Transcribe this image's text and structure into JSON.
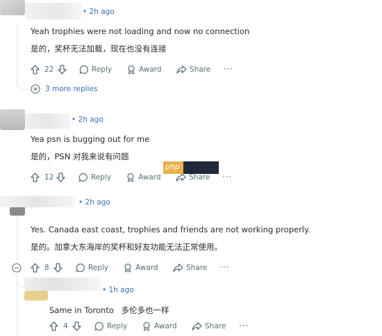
{
  "comments": [
    {
      "time": "• 2h ago",
      "text_en": "Yeah trophies were not loading and now no connection",
      "text_zh": "是的，奖杯无法加载，现在也没有连接",
      "votes": "22",
      "reply": "Reply",
      "award": "Award",
      "share": "Share",
      "more": "···",
      "replies_link": "3 more replies"
    },
    {
      "time": "• 2h ago",
      "text_en": "Yea psn is bugging out for me",
      "text_zh": "是的，PSN 对我来说有问题",
      "votes": "12",
      "reply": "Reply",
      "award": "Award",
      "share": "Share",
      "more": "···",
      "watermark": "php"
    },
    {
      "time": "• 2h ago",
      "text_en": "Yes. Canada east coast, trophies and friends are not working properly.",
      "text_zh": "是的。加拿大东海岸的奖杯和好友功能无法正常使用。",
      "votes": "8",
      "reply": "Reply",
      "award": "Award",
      "share": "Share",
      "more": "···"
    },
    {
      "time": "• 1h ago",
      "text_en": "Same in Toronto",
      "text_zh": "多伦多也一样",
      "votes": "4",
      "reply": "Reply",
      "award": "Award",
      "share": "Share",
      "more": "···"
    }
  ],
  "colors": {
    "link": "#3b6fb6",
    "meta": "#576f76",
    "text": "#2a2a2a",
    "thread": "#e3e6e8"
  }
}
